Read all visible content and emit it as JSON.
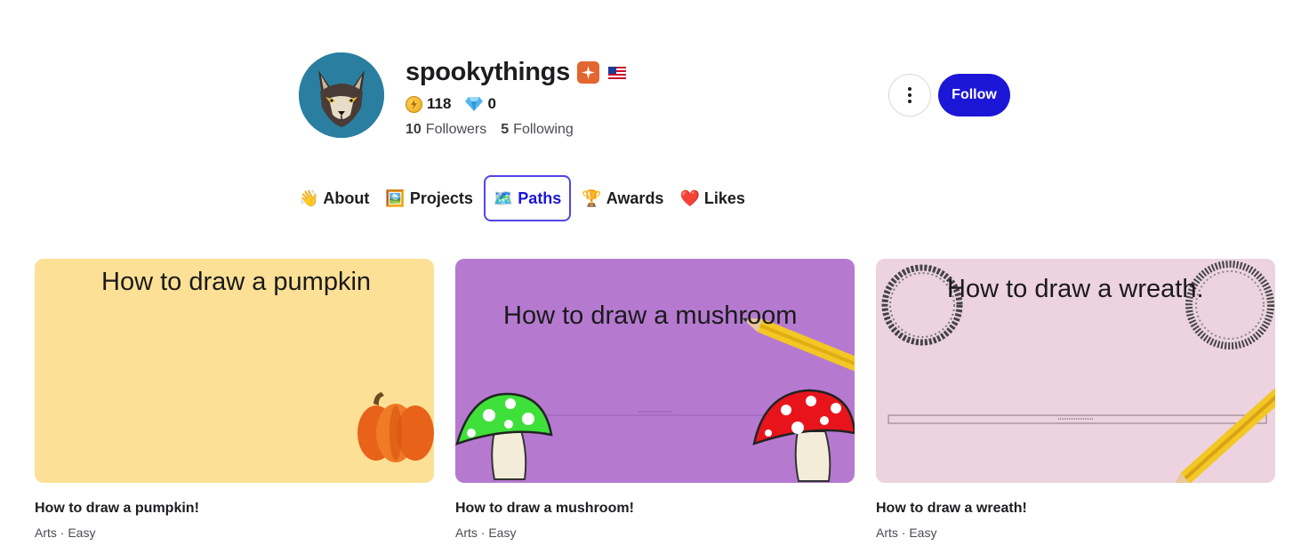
{
  "profile": {
    "username": "spookythings",
    "coins": "118",
    "gems": "0",
    "followers_count": "10",
    "followers_label": "Followers",
    "following_count": "5",
    "following_label": "Following",
    "follow_label": "Follow"
  },
  "tabs": [
    {
      "icon": "👋",
      "label": "About"
    },
    {
      "icon": "🖼️",
      "label": "Projects"
    },
    {
      "icon": "🗺️",
      "label": "Paths"
    },
    {
      "icon": "🏆",
      "label": "Awards"
    },
    {
      "icon": "❤️",
      "label": "Likes"
    }
  ],
  "active_tab": "Paths",
  "cards": [
    {
      "thumb_text": "How to draw a pumpkin",
      "title": "How to draw a pumpkin!",
      "category": "Arts",
      "level": "Easy",
      "bg": "#fce095"
    },
    {
      "thumb_text": "How to draw a mushroom",
      "title": "How to draw a mushroom!",
      "category": "Arts",
      "level": "Easy",
      "bg": "#b57ad0"
    },
    {
      "thumb_text": "How to draw a wreath.",
      "title": "How to draw a wreath!",
      "category": "Arts",
      "level": "Easy",
      "bg": "#ecd3df"
    }
  ],
  "colors": {
    "accent": "#1c17d6",
    "badge": "#e2662f",
    "avatar_bg": "#2a7fa0"
  },
  "icons": {
    "badge": "sparkle-badge-icon",
    "flag": "us-flag-icon",
    "coins": "coin-icon",
    "gems": "gem-icon",
    "more": "more-vertical-icon"
  }
}
